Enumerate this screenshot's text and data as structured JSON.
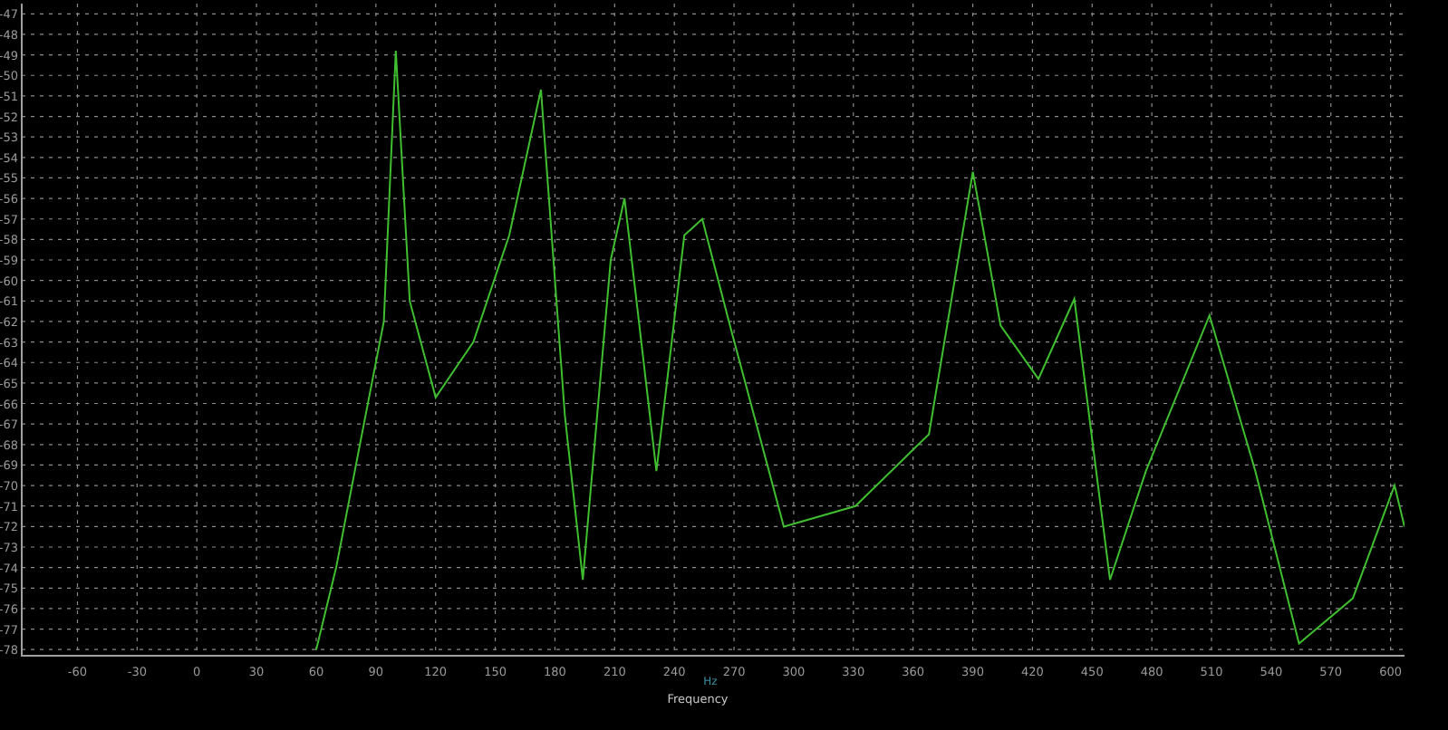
{
  "plot": {
    "x_unit": "Hz",
    "chart_data": {
      "type": "line",
      "grid": true,
      "xlabel": "Frequency",
      "xlim": [
        -88,
        607
      ],
      "ylim": [
        -78.3,
        -46.5
      ],
      "xticks": [
        -60,
        -30,
        0,
        30,
        60,
        90,
        120,
        150,
        180,
        210,
        240,
        270,
        300,
        330,
        360,
        390,
        420,
        450,
        480,
        510,
        540,
        570,
        600
      ],
      "yticks": [
        -47,
        -48,
        -49,
        -50,
        -51,
        -52,
        -53,
        -54,
        -55,
        -56,
        -57,
        -58,
        -59,
        -60,
        -61,
        -62,
        -63,
        -64,
        -65,
        -66,
        -67,
        -68,
        -69,
        -70,
        -71,
        -72,
        -73,
        -74,
        -75,
        -76,
        -77,
        -78
      ],
      "series": [
        {
          "color": "#3fbf2f",
          "x": [
            60,
            70,
            83,
            94,
            100,
            107,
            120,
            139,
            157,
            173,
            185,
            194,
            208,
            215,
            231,
            245,
            254,
            268,
            295,
            331,
            368,
            390,
            404,
            423,
            441,
            459,
            477,
            509,
            532,
            554,
            581,
            602,
            607
          ],
          "values": [
            -78,
            -74,
            -67.5,
            -62,
            -48.8,
            -61,
            -65.7,
            -63,
            -57.8,
            -50.7,
            -66.6,
            -74.6,
            -59,
            -56,
            -69.3,
            -57.8,
            -57,
            -62.2,
            -72,
            -71,
            -67.5,
            -54.7,
            -62.2,
            -64.8,
            -60.9,
            -74.6,
            -69.3,
            -61.7,
            -69.3,
            -77.7,
            -75.5,
            -70,
            -72
          ]
        }
      ]
    }
  }
}
